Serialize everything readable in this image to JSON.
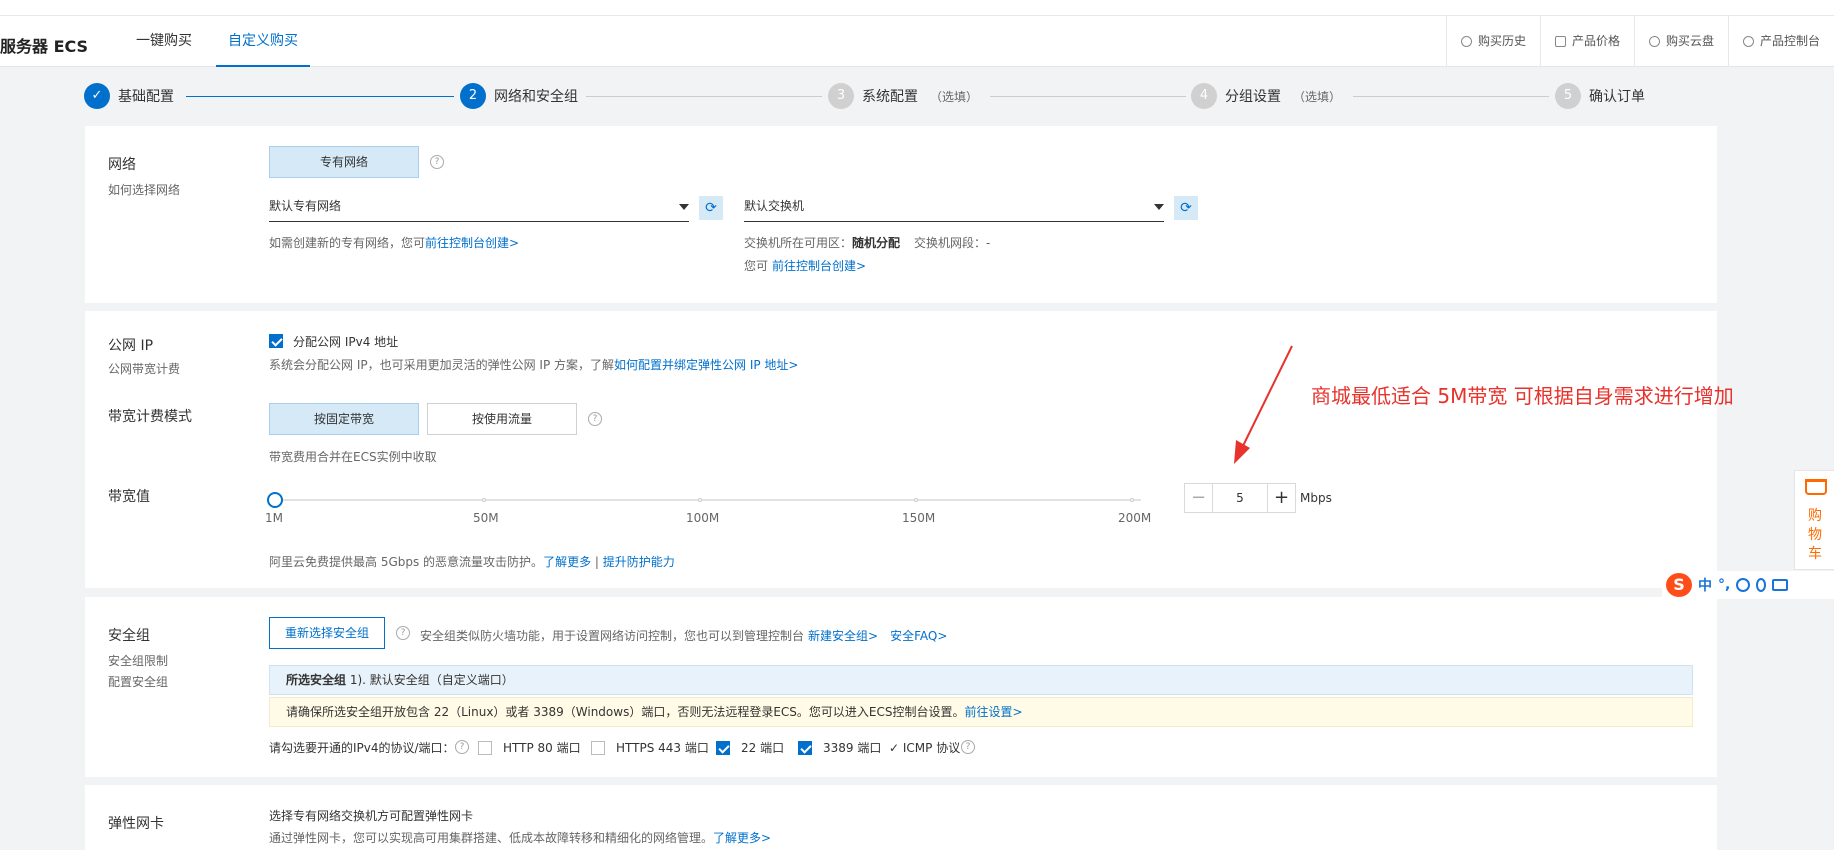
{
  "header": {
    "title": "服务器 ECS",
    "tabs": [
      {
        "label": "一键购买",
        "active": false
      },
      {
        "label": "自定义购买",
        "active": true
      }
    ],
    "links": [
      {
        "label": "购买历史",
        "icon": "clock-icon"
      },
      {
        "label": "产品价格",
        "icon": "document-icon"
      },
      {
        "label": "购买云盘",
        "icon": "cloud-icon"
      },
      {
        "label": "产品控制台",
        "icon": "gear-icon"
      }
    ]
  },
  "steps": [
    {
      "num": "✓",
      "label": "基础配置",
      "optional": "",
      "state": "done"
    },
    {
      "num": "2",
      "label": "网络和安全组",
      "optional": "",
      "state": "current"
    },
    {
      "num": "3",
      "label": "系统配置",
      "optional": "（选填）",
      "state": "pending"
    },
    {
      "num": "4",
      "label": "分组设置",
      "optional": "（选填）",
      "state": "pending"
    },
    {
      "num": "5",
      "label": "确认订单",
      "optional": "",
      "state": "pending"
    }
  ],
  "network": {
    "label": "网络",
    "sub": "如何选择网络",
    "type_button": "专有网络",
    "help": "?",
    "vpc_select": "默认专有网络",
    "vpc_hint": "如需创建新的专有网络，您可",
    "vpc_hint_link": "前往控制台创建>",
    "vswitch_select": "默认交换机",
    "zone_label": "交换机所在可用区：",
    "zone_value": "随机分配",
    "segment_label": "交换机网段：",
    "segment_value": "-",
    "vswitch_hint": "您可",
    "vswitch_hint_link": "前往控制台创建>"
  },
  "public_ip": {
    "label": "公网 IP",
    "sub": "公网带宽计费",
    "checkbox_label": "分配公网 IPv4 地址",
    "checked": true,
    "desc": "系统会分配公网 IP，也可采用更加灵活的弹性公网 IP 方案，了解",
    "desc_link": "如何配置并绑定弹性公网 IP 地址>"
  },
  "billing": {
    "label": "带宽计费模式",
    "options": [
      {
        "label": "按固定带宽",
        "selected": true
      },
      {
        "label": "按使用流量",
        "selected": false
      }
    ],
    "help": "?",
    "note": "带宽费用合并在ECS实例中收取"
  },
  "bandwidth": {
    "label": "带宽值",
    "ticks": [
      "1M",
      "50M",
      "100M",
      "150M",
      "200M"
    ],
    "value": "5",
    "unit": "Mbps",
    "minus": "−",
    "plus": "+",
    "ddos_text": "阿里云免费提供最高 5Gbps 的恶意流量攻击防护。",
    "ddos_link1": "了解更多",
    "ddos_sep": " | ",
    "ddos_link2": "提升防护能力"
  },
  "annotation": "商城最低适合 5M带宽    可根据自身需求进行增加",
  "security_group": {
    "label": "安全组",
    "sub1": "安全组限制",
    "sub2": "配置安全组",
    "reselect_button": "重新选择安全组",
    "help": "?",
    "desc": "安全组类似防火墙功能，用于设置网络访问控制，您也可以到管理控制台",
    "link_new": "新建安全组>",
    "link_faq": "安全FAQ>",
    "selected_label": "所选安全组",
    "selected_value": "1). 默认安全组（自定义端口）",
    "warning": "请确保所选安全组开放包含 22（Linux）或者 3389（Windows）端口，否则无法远程登录ECS。您可以进入ECS控制台设置。",
    "warning_link": "前往设置>",
    "ports_label": "请勾选要开通的IPv4的协议/端口：",
    "ports": [
      {
        "label": "HTTP 80 端口",
        "checked": false
      },
      {
        "label": "HTTPS 443 端口",
        "checked": false
      },
      {
        "label": "22 端口",
        "checked": true
      },
      {
        "label": "3389 端口",
        "checked": true
      }
    ],
    "icmp_label": "✓ ICMP 协议"
  },
  "eni": {
    "label": "弹性网卡",
    "line1": "选择专有网络交换机方可配置弹性网卡",
    "line2": "通过弹性网卡，您可以实现高可用集群搭建、低成本故障转移和精细化的网络管理。",
    "line2_link": "了解更多>"
  },
  "cart": {
    "label": "购物车"
  },
  "ime": {
    "logo": "S",
    "items": [
      "中",
      "°,"
    ]
  },
  "colors": {
    "accent": "#0070cc",
    "annotation": "#e8322c",
    "brand": "#ff6a00"
  }
}
